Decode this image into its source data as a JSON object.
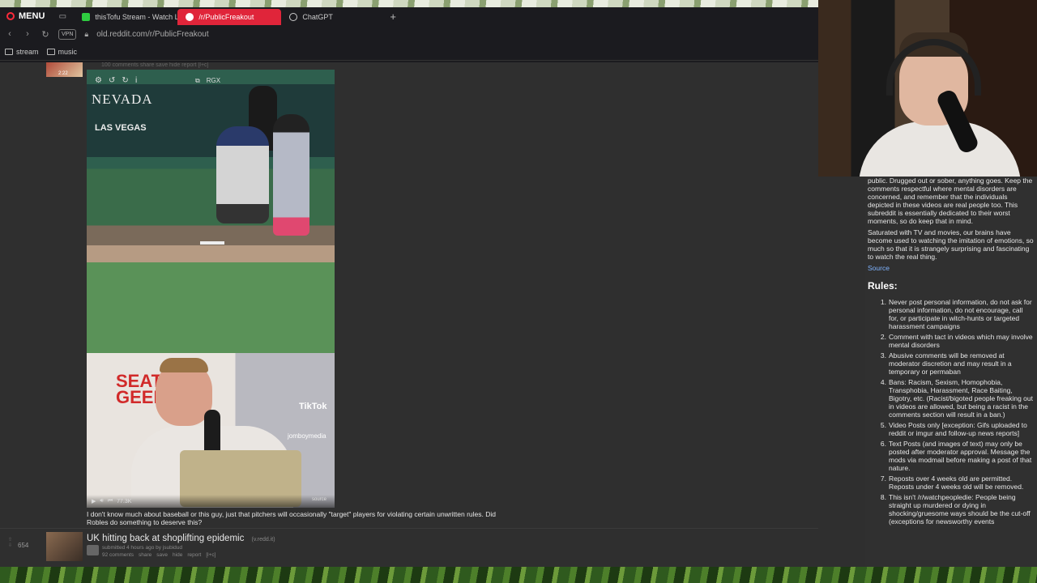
{
  "browser": {
    "menu_label": "MENU",
    "tabs": [
      {
        "label": "thisTofu Stream - Watch L",
        "active": false
      },
      {
        "label": "/r/PublicFreakout",
        "active": true
      },
      {
        "label": "ChatGPT",
        "active": false
      }
    ],
    "new_tab": "+",
    "vpn": "VPN",
    "url": "old.reddit.com/r/PublicFreakout",
    "bookmarks": [
      "stream",
      "music"
    ]
  },
  "post1": {
    "ghost_meta": "100 comments  share  save  hide  report  [l+c]",
    "thumb_time": "2:22",
    "video": {
      "banner_text": "NEVADA",
      "banner_sub": "LAS VEGAS",
      "rgx": "RGX",
      "sponsor": "SEAT GEEK",
      "tiktok": "TikTok",
      "tiktok_handle": "jomboymedia",
      "views": "77.3K",
      "source": "source"
    },
    "caption": "I don't know much about baseball or this guy, just that pitchers will occasionally \"target\" players for violating certain unwritten rules. Did Robles do something to deserve this?"
  },
  "post2": {
    "score": "654",
    "title": "UK hitting back at shoplifting epidemic",
    "domain": "(v.redd.it)",
    "submitted": "submitted 4 hours ago by jsubidud",
    "actions": [
      "92 comments",
      "share",
      "save",
      "hide",
      "report",
      "[l+c]"
    ]
  },
  "sidebar": {
    "intro_partial": "public. Drugged out or sober, anything goes. Keep the comments respectful where mental disorders are concerned, and remember that the individuals depicted in these videos are real people too. This subreddit is essentially dedicated to their worst moments, so do keep that in mind.",
    "intro2": "Saturated with TV and movies, our brains have become used to watching the imitation of emotions, so much so that it is strangely surprising and fascinating to watch the real thing.",
    "source_link": "Source",
    "rules_heading": "Rules:",
    "rules": [
      {
        "num": "1.",
        "text": "Never post personal information, do not ask for personal information, do not encourage, call for, or participate in witch-hunts or targeted harassment campaigns"
      },
      {
        "num": "2.",
        "text": "Comment with tact in videos which may involve mental disorders"
      },
      {
        "num": "3.",
        "text": "Abusive comments will be removed at moderator discretion and may result in a temporary or permaban"
      },
      {
        "num": "4.",
        "text": "Bans: Racism, Sexism, Homophobia, Transphobia, Harassment, Race Baiting, Bigotry, etc. (Racist/bigoted people freaking out in videos are allowed, but being a racist in the comments section will result in a ban.)"
      },
      {
        "num": "5.",
        "text": "Video Posts only [exception: Gifs uploaded to reddit or imgur and follow-up news reports]"
      },
      {
        "num": "6.",
        "text": "Text Posts (and images of text) may only be posted after moderator approval. Message the mods via modmail before making a post of that nature."
      },
      {
        "num": "7.",
        "text": "Reposts over 4 weeks old are permitted. Reposts under 4 weeks old will be removed."
      },
      {
        "num": "8.",
        "text": "This isn't /r/watchpeopledie: People being straight up murdered or dying in shocking/gruesome ways should be the cut-off (exceptions for newsworthy events"
      }
    ]
  }
}
